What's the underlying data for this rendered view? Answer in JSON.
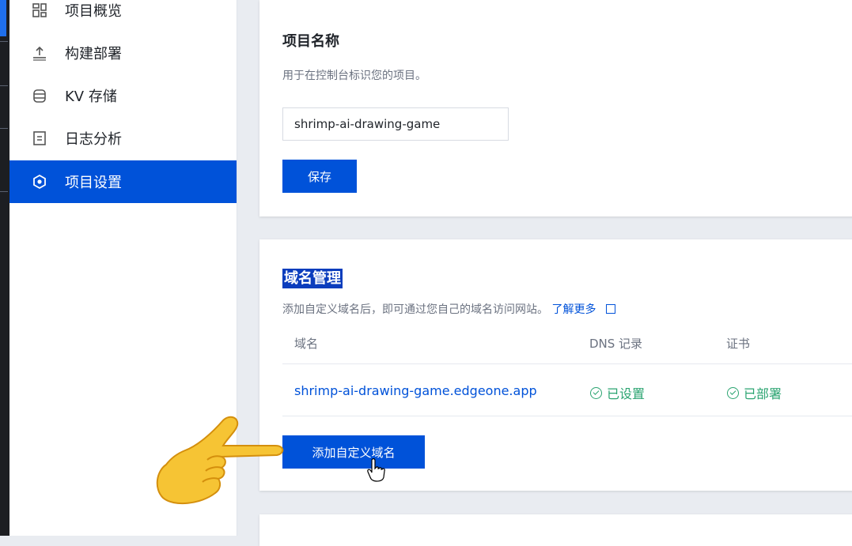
{
  "sidebar": {
    "items": [
      {
        "label": "项目概览",
        "icon": "overview-icon"
      },
      {
        "label": "构建部署",
        "icon": "upload-icon"
      },
      {
        "label": "KV 存储",
        "icon": "database-icon"
      },
      {
        "label": "日志分析",
        "icon": "log-icon"
      },
      {
        "label": "项目设置",
        "icon": "settings-icon",
        "active": true
      }
    ]
  },
  "project_name_card": {
    "title": "项目名称",
    "description": "用于在控制台标识您的项目。",
    "input_value": "shrimp-ai-drawing-game",
    "save_label": "保存"
  },
  "domain_card": {
    "title": "域名管理",
    "description": "添加自定义域名后，即可通过您自己的域名访问网站。",
    "learn_more": "了解更多",
    "columns": [
      "域名",
      "DNS 记录",
      "证书"
    ],
    "rows": [
      {
        "domain": "shrimp-ai-drawing-game.edgeone.app",
        "dns": "已设置",
        "cert": "已部署"
      }
    ],
    "add_label": "添加自定义域名"
  },
  "colors": {
    "primary": "#0052d9",
    "success": "#2ba471"
  }
}
